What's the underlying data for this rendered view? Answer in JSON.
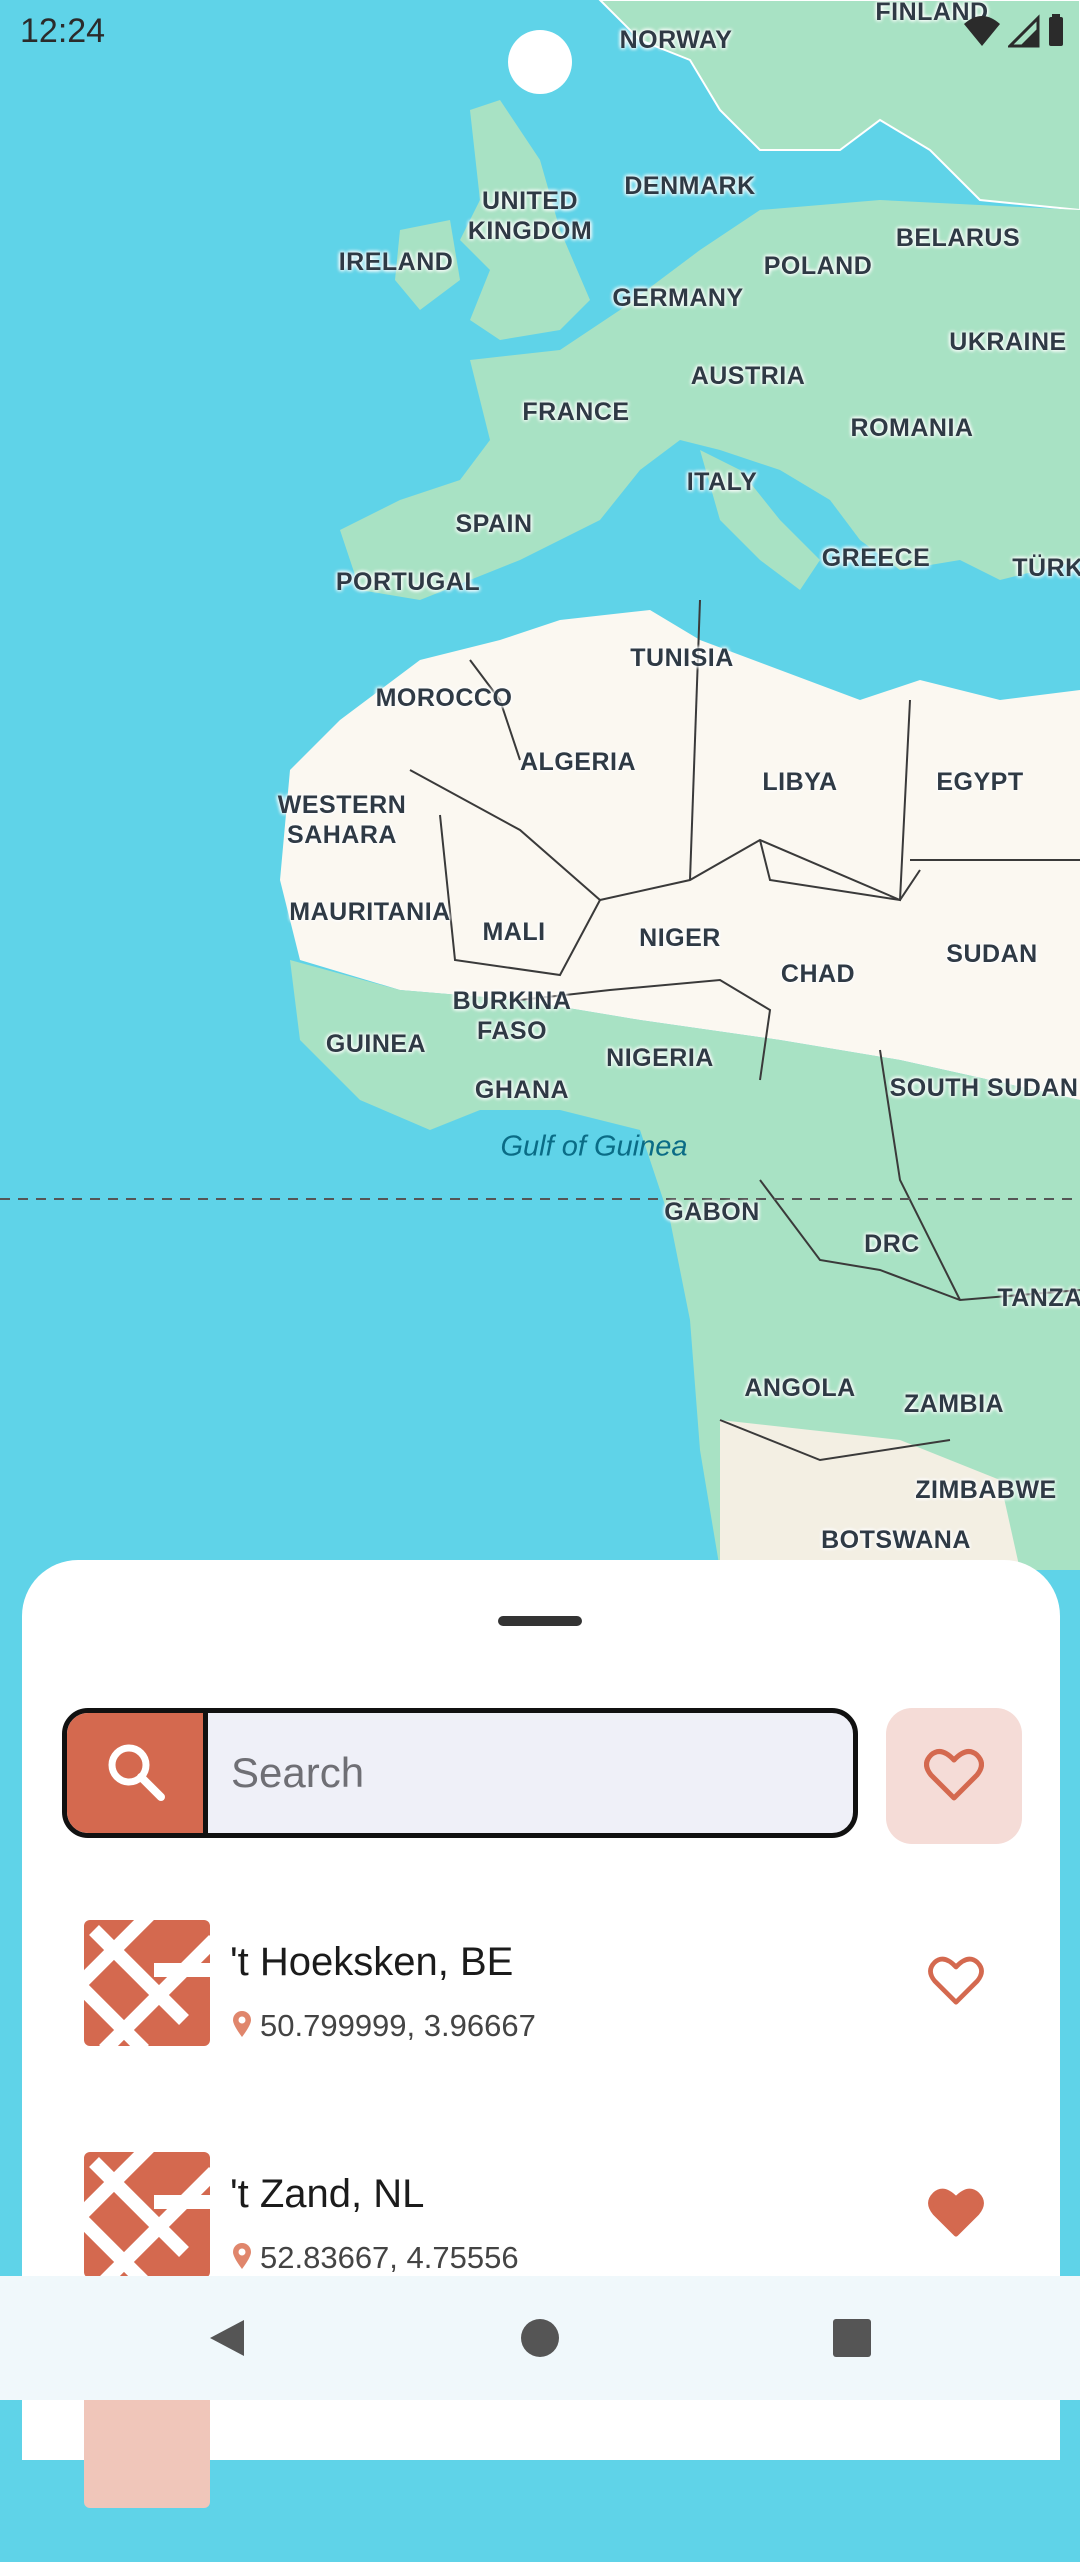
{
  "status_bar": {
    "time": "12:24",
    "icons": [
      "wifi-icon",
      "signal-icon",
      "battery-icon"
    ]
  },
  "map": {
    "colors": {
      "water": "#5fd3e8",
      "land": "#a8e2c4",
      "desert": "#fbf8f1",
      "border": "#3a3a3a"
    },
    "countries": [
      {
        "id": "norway",
        "label": "NORWAY"
      },
      {
        "id": "finland",
        "label": "FINLAND"
      },
      {
        "id": "denmark",
        "label": "DENMARK"
      },
      {
        "id": "united-kingdom",
        "label": "UNITED\nKINGDOM"
      },
      {
        "id": "ireland",
        "label": "IRELAND"
      },
      {
        "id": "belarus",
        "label": "BELARUS"
      },
      {
        "id": "poland",
        "label": "POLAND"
      },
      {
        "id": "germany",
        "label": "GERMANY"
      },
      {
        "id": "ukraine",
        "label": "UKRAINE"
      },
      {
        "id": "austria",
        "label": "AUSTRIA"
      },
      {
        "id": "france",
        "label": "FRANCE"
      },
      {
        "id": "romania",
        "label": "ROMANIA"
      },
      {
        "id": "italy",
        "label": "ITALY"
      },
      {
        "id": "spain",
        "label": "SPAIN"
      },
      {
        "id": "greece",
        "label": "GREECE"
      },
      {
        "id": "turkey",
        "label": "TÜRK"
      },
      {
        "id": "portugal",
        "label": "PORTUGAL"
      },
      {
        "id": "tunisia",
        "label": "TUNISIA"
      },
      {
        "id": "morocco",
        "label": "MOROCCO"
      },
      {
        "id": "algeria",
        "label": "ALGERIA"
      },
      {
        "id": "libya",
        "label": "LIBYA"
      },
      {
        "id": "egypt",
        "label": "EGYPT"
      },
      {
        "id": "western-sahara",
        "label": "WESTERN\nSAHARA"
      },
      {
        "id": "mauritania",
        "label": "MAURITANIA"
      },
      {
        "id": "mali",
        "label": "MALI"
      },
      {
        "id": "niger",
        "label": "NIGER"
      },
      {
        "id": "sudan",
        "label": "SUDAN"
      },
      {
        "id": "chad",
        "label": "CHAD"
      },
      {
        "id": "burkina-faso",
        "label": "BURKINA\nFASO"
      },
      {
        "id": "guinea",
        "label": "GUINEA"
      },
      {
        "id": "nigeria",
        "label": "NIGERIA"
      },
      {
        "id": "ghana",
        "label": "GHANA"
      },
      {
        "id": "south-sudan",
        "label": "SOUTH SUDAN"
      },
      {
        "id": "gabon",
        "label": "GABON"
      },
      {
        "id": "drc",
        "label": "DRC"
      },
      {
        "id": "tanzania",
        "label": "TANZA"
      },
      {
        "id": "angola",
        "label": "ANGOLA"
      },
      {
        "id": "zambia",
        "label": "ZAMBIA"
      },
      {
        "id": "zimbabwe",
        "label": "ZIMBABWE"
      },
      {
        "id": "botswana",
        "label": "BOTSWANA"
      }
    ],
    "sea_label": "Gulf of Guinea"
  },
  "sheet": {
    "search": {
      "placeholder": "Search",
      "value": ""
    },
    "accent_color": "#d4694f",
    "places": [
      {
        "name": "'t Hoeksken, BE",
        "coords": "50.799999, 3.96667",
        "favorite": false
      },
      {
        "name": "'t Zand, NL",
        "coords": "52.83667, 4.75556",
        "favorite": true
      }
    ]
  },
  "nav_bar": {
    "buttons": [
      "back",
      "home",
      "recents"
    ]
  }
}
